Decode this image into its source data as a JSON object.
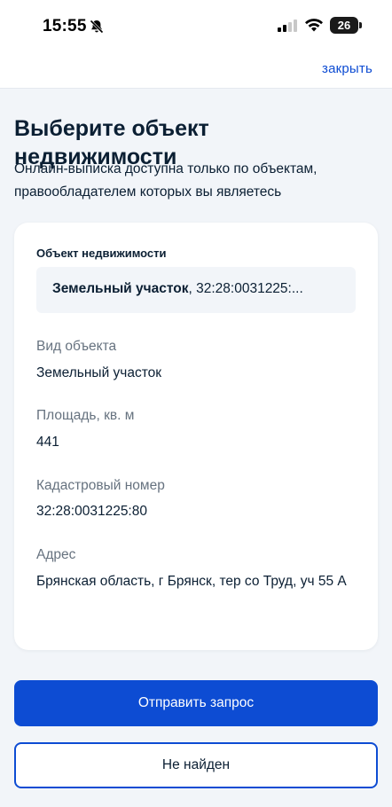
{
  "status_bar": {
    "time": "15:55",
    "battery": "26"
  },
  "top_bar": {
    "close_label": "закрыть"
  },
  "page": {
    "title": "Выберите объект недвижимости",
    "description": "Онлайн-выписка доступна только по объектам, правообладателем которых вы являетесь"
  },
  "object_select": {
    "label": "Объект недвижимости",
    "value_type": "Земельный участок",
    "value_rest": ", 32:28:0031225:..."
  },
  "details": {
    "object_type_label": "Вид объекта",
    "object_type_value": "Земельный участок",
    "area_label": "Площадь, кв. м",
    "area_value": "441",
    "cadastral_label": "Кадастровый номер",
    "cadastral_value": "32:28:0031225:80",
    "address_label": "Адрес",
    "address_value": "Брянская область, г Брянск, тер со Труд, уч 55 А"
  },
  "actions": {
    "submit_label": "Отправить запрос",
    "not_found_label": "Не найден"
  },
  "colors": {
    "accent": "#0d4cd3",
    "background": "#f2f5f9",
    "text": "#0b1f33",
    "muted": "#66727f"
  }
}
